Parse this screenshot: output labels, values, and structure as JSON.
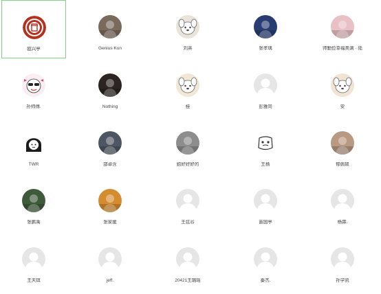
{
  "contacts": [
    {
      "name": "瓯兴亭",
      "avatar": "university-seal-icon",
      "color": "#b5301f"
    },
    {
      "name": "Genius Kun",
      "avatar": "person-photo-icon",
      "color": "#7a6a5c"
    },
    {
      "name": "刘英",
      "avatar": "cartoon-dog-icon",
      "color": "#e9e3da"
    },
    {
      "name": "张孝璃",
      "avatar": "anime-character-icon",
      "color": "#2a3d73"
    },
    {
      "name": "师勤俭幸福美满 · 陆",
      "avatar": "girl-photo-icon",
      "color": "#e9c0c5"
    },
    {
      "name": "孙师傅.",
      "avatar": "cartoon-face-icon",
      "color": "#f0d8e0"
    },
    {
      "name": "Nothing",
      "avatar": "baby-photo-icon",
      "color": "#2b2420"
    },
    {
      "name": "桂",
      "avatar": "cartoon-sheep-icon",
      "color": "#f1e7d6"
    },
    {
      "name": "彭雅同",
      "avatar": "default-avatar-icon",
      "color": "#e3e3e3"
    },
    {
      "name": "安",
      "avatar": "cartoon-sheep-icon",
      "color": "#f0e4d3"
    },
    {
      "name": "TWR",
      "avatar": "cartoon-girl-icon",
      "color": "#1f1f1f"
    },
    {
      "name": "邵卓含",
      "avatar": "dark-photo-icon",
      "color": "#4f5663"
    },
    {
      "name": "姐好好好的",
      "avatar": "cat-photo-icon",
      "color": "#8d8d8d"
    },
    {
      "name": "王杨",
      "avatar": "doodle-icon",
      "color": "#6b6b6b"
    },
    {
      "name": "郁佩硕",
      "avatar": "portrait-photo-icon",
      "color": "#b89982"
    },
    {
      "name": "张鹏禹",
      "avatar": "nature-photo-icon",
      "color": "#3e5a3a"
    },
    {
      "name": "张家媛",
      "avatar": "sunset-photo-icon",
      "color": "#d48c2f"
    },
    {
      "name": "王弦谷",
      "avatar": "default-avatar-icon",
      "color": "#e3e3e3"
    },
    {
      "name": "苗园亭",
      "avatar": "default-avatar-icon",
      "color": "#e3e3e3"
    },
    {
      "name": "杨霖.",
      "avatar": "default-avatar-icon",
      "color": "#e3e3e3"
    },
    {
      "name": "王天琪",
      "avatar": "default-avatar-icon",
      "color": "#e3e3e3"
    },
    {
      "name": "jeff.",
      "avatar": "default-avatar-icon",
      "color": "#e3e3e3"
    },
    {
      "name": "20421王璐瑶",
      "avatar": "default-avatar-icon",
      "color": "#e3e3e3"
    },
    {
      "name": "秦杰.",
      "avatar": "default-avatar-icon",
      "color": "#e3e3e3"
    },
    {
      "name": "孙学凯",
      "avatar": "default-avatar-icon",
      "color": "#e3e3e3"
    }
  ],
  "colors": {
    "selected_border": "#7fd18a",
    "default_avatar_bg": "#e3e3e3",
    "default_avatar_fg": "#ffffff"
  }
}
